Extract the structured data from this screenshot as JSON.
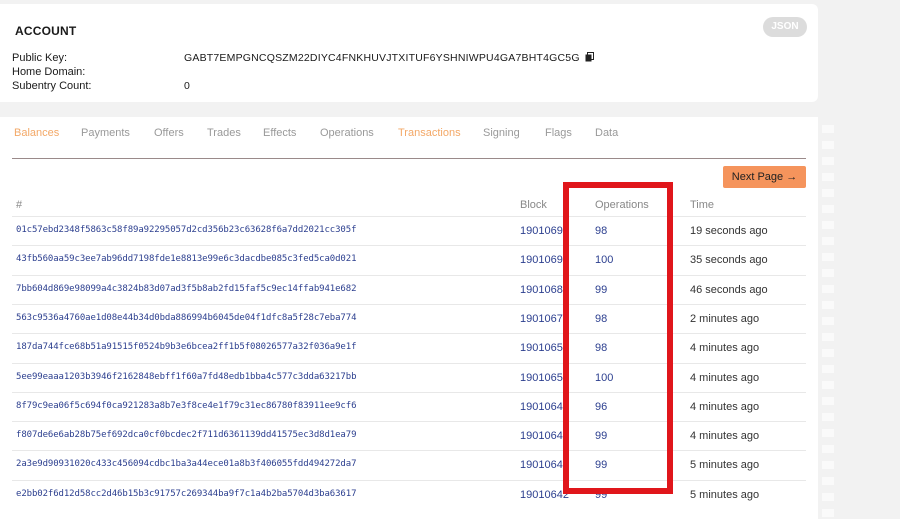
{
  "account": {
    "title": "ACCOUNT",
    "json_label": "JSON",
    "public_key_label": "Public Key:",
    "public_key": "GABT7EMPGNCQSZM22DIYC4FNKHUVJTXITUF6YSHNIWPU4GA7BHT4GC5G",
    "home_domain_label": "Home Domain:",
    "home_domain": "",
    "subentry_label": "Subentry Count:",
    "subentry_count": "0"
  },
  "tabs": [
    {
      "label": "Balances",
      "accent": true
    },
    {
      "label": "Payments",
      "accent": false
    },
    {
      "label": "Offers",
      "accent": false
    },
    {
      "label": "Trades",
      "accent": false
    },
    {
      "label": "Effects",
      "accent": false
    },
    {
      "label": "Operations",
      "accent": false
    },
    {
      "label": "Transactions",
      "accent": true
    },
    {
      "label": "Signing",
      "accent": false
    },
    {
      "label": "Flags",
      "accent": false
    },
    {
      "label": "Data",
      "accent": false
    }
  ],
  "pager": {
    "next_label": "Next Page →"
  },
  "table": {
    "headers": {
      "hash": "#",
      "block": "Block",
      "operations": "Operations",
      "time": "Time"
    },
    "rows": [
      {
        "hash": "01c57ebd2348f5863c58f89a92295057d2cd356b23c63628f6a7dd2021cc305f",
        "block": "19010691",
        "operations": "98",
        "time": "19 seconds ago"
      },
      {
        "hash": "43fb560aa59c3ee7ab96dd7198fde1e8813e99e6c3dacdbe085c3fed5ca0d021",
        "block": "19010691",
        "operations": "100",
        "time": "35 seconds ago"
      },
      {
        "hash": "7bb604d869e98099a4c3824b83d07ad3f5b8ab2fd15faf5c9ec14ffab941e682",
        "block": "19010688",
        "operations": "99",
        "time": "46 seconds ago"
      },
      {
        "hash": "563c9536a4760ae1d08e44b34d0bda886994b6045de04f1dfc8a5f28c7eba774",
        "block": "19010677",
        "operations": "98",
        "time": "2 minutes ago"
      },
      {
        "hash": "187da744fce68b51a91515f0524b9b3e6bcea2ff1b5f08026577a32f036a9e1f",
        "block": "19010657",
        "operations": "98",
        "time": "4 minutes ago"
      },
      {
        "hash": "5ee99eaaa1203b3946f2162848ebff1f60a7fd48edb1bba4c577c3dda63217bb",
        "block": "19010656",
        "operations": "100",
        "time": "4 minutes ago"
      },
      {
        "hash": "8f79c9ea06f5c694f0ca921283a8b7e3f8ce4e1f79c31ec86780f83911ee9cf6",
        "block": "19010646",
        "operations": "96",
        "time": "4 minutes ago"
      },
      {
        "hash": "f807de6e6ab28b75ef692dca0cf0bcdec2f711d6361139dd41575ec3d8d1ea79",
        "block": "19010645",
        "operations": "99",
        "time": "4 minutes ago"
      },
      {
        "hash": "2a3e9d90931020c433c456094cdbc1ba3a44ece01a8b3f406055fdd494272da7",
        "block": "19010644",
        "operations": "99",
        "time": "5 minutes ago"
      },
      {
        "hash": "e2bb02f6d12d58cc2d46b15b3c91757c269344ba9f7c1a4b2ba5704d3ba63617",
        "block": "19010642",
        "operations": "99",
        "time": "5 minutes ago"
      }
    ]
  },
  "colors": {
    "accent_tab": "#f3a867",
    "button": "#f5945c",
    "link": "#2c3f8f",
    "highlight_border": "#e0161b"
  }
}
